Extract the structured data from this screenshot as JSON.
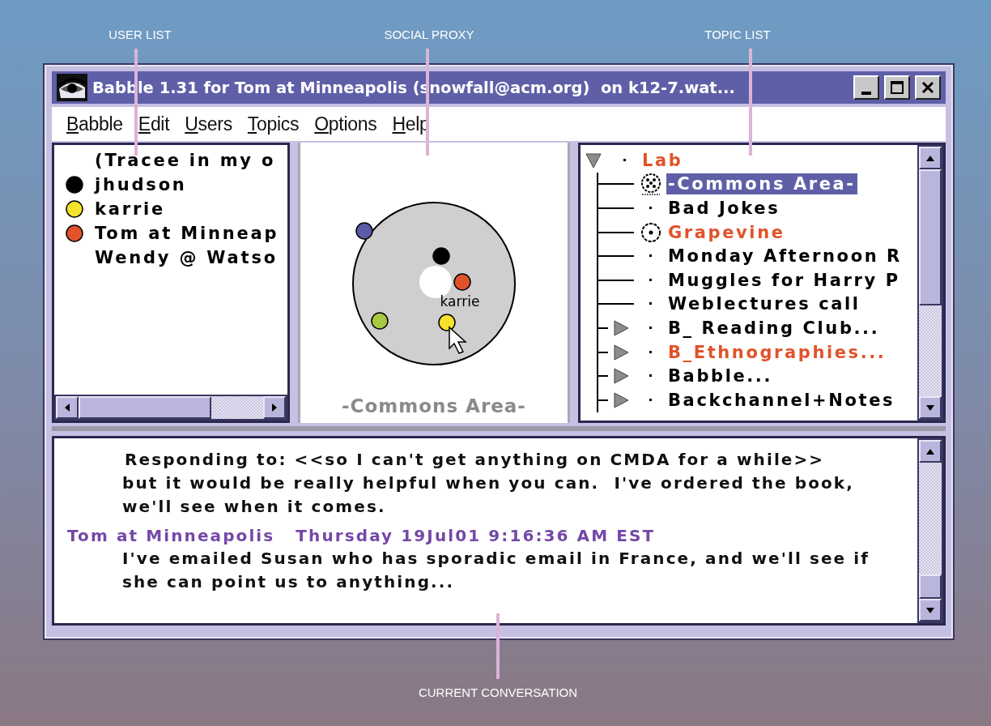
{
  "annotations": [
    {
      "label": "USER LIST"
    },
    {
      "label": "SOCIAL PROXY"
    },
    {
      "label": "TOPIC LIST"
    },
    {
      "label": "CURRENT CONVERSATION"
    }
  ],
  "window": {
    "title": "Babble 1.31 for Tom at Minneapolis (snowfall@acm.org)  on k12-7.wat..."
  },
  "menu": [
    {
      "label": "Babble"
    },
    {
      "label": "Edit"
    },
    {
      "label": "Users"
    },
    {
      "label": "Topics"
    },
    {
      "label": "Options"
    },
    {
      "label": "Help"
    }
  ],
  "user_list": [
    {
      "name": "(Tracee in my o"
    },
    {
      "name": "jhudson",
      "color": "#000000"
    },
    {
      "name": "karrie",
      "color": "#f5e22c"
    },
    {
      "name": "Tom at Minneap",
      "color": "#e2522a"
    },
    {
      "name": "Wendy @ Watso"
    }
  ],
  "social_proxy": {
    "room": "-Commons Area-",
    "dots": [
      {
        "color": "#5a5aa6"
      },
      {
        "color": "#000000"
      },
      {
        "color": "#e2522a"
      },
      {
        "color": "#a8c840"
      },
      {
        "color": "#f5e22c",
        "name": "karrie"
      }
    ]
  },
  "topics": [
    {
      "label": "Lab",
      "kind": "folder",
      "expanded": true,
      "color": "#e2522a",
      "selected": false,
      "children": [
        {
          "label": "-Commons Area-",
          "kind": "occupied-room",
          "selected": true
        },
        {
          "label": "Bad Jokes",
          "kind": "topic",
          "color": "#000000",
          "selected": false
        },
        {
          "label": "Grapevine",
          "kind": "room",
          "color": "#e2522a",
          "selected": false
        },
        {
          "label": "Monday Afternoon R",
          "kind": "topic",
          "color": "#000000",
          "selected": false
        },
        {
          "label": "Muggles for Harry P",
          "kind": "topic",
          "color": "#000000",
          "selected": false
        },
        {
          "label": "Weblectures call",
          "kind": "topic",
          "color": "#000000",
          "selected": false
        },
        {
          "label": "B_ Reading Club...",
          "kind": "folder",
          "expanded": false,
          "color": "#000000",
          "selected": false
        },
        {
          "label": "B_Ethnographies...",
          "kind": "folder",
          "expanded": false,
          "color": "#e2522a",
          "selected": false
        },
        {
          "label": "Babble...",
          "kind": "folder",
          "expanded": false,
          "color": "#000000",
          "selected": false
        },
        {
          "label": "Backchannel+Notes",
          "kind": "folder",
          "expanded": false,
          "color": "#000000",
          "selected": false
        }
      ]
    }
  ],
  "conversation": [
    {
      "kind": "quote",
      "text": "Responding to: <<so I can't get anything on CMDA for a while>>"
    },
    {
      "kind": "body",
      "text": "but it would be really helpful when you can.  I've ordered the book, we'll see when it comes."
    },
    {
      "kind": "header",
      "author": "Tom at Minneapolis",
      "time": "Thursday 19Jul01 9:16:36 AM EST"
    },
    {
      "kind": "body",
      "text": "I've emailed Susan who has sporadic email in France, and we'll see if she can point us to anything..."
    }
  ]
}
